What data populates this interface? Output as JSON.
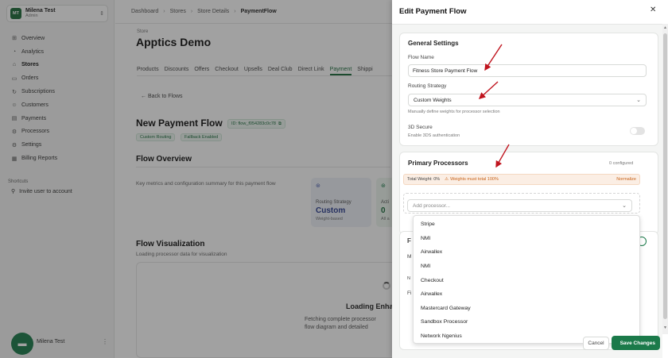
{
  "workspace": {
    "initials": "MT",
    "name": "Milena Test",
    "role": "Admin"
  },
  "sidebar": {
    "items": [
      {
        "label": "Overview",
        "icon": "grid-icon",
        "glyph": "⊞"
      },
      {
        "label": "Analytics",
        "icon": "analytics-icon",
        "glyph": "◔"
      },
      {
        "label": "Stores",
        "icon": "store-icon",
        "glyph": "⌂"
      },
      {
        "label": "Orders",
        "icon": "orders-icon",
        "glyph": "▭"
      },
      {
        "label": "Subscriptions",
        "icon": "subscriptions-icon",
        "glyph": "↻"
      },
      {
        "label": "Customers",
        "icon": "customers-icon",
        "glyph": "☺"
      },
      {
        "label": "Payments",
        "icon": "payments-icon",
        "glyph": "▤"
      },
      {
        "label": "Processors",
        "icon": "processors-icon",
        "glyph": "⚙"
      },
      {
        "label": "Settings",
        "icon": "settings-icon",
        "glyph": "⚙"
      },
      {
        "label": "Billing Reports",
        "icon": "billing-icon",
        "glyph": "▦"
      }
    ],
    "shortcuts_label": "Shortcuts",
    "shortcut_invite": "Invite user to account",
    "user_name": "Milena Test"
  },
  "breadcrumb": {
    "items": [
      "Dashboard",
      "Stores",
      "Store Details",
      "PaymentFlow"
    ]
  },
  "store": {
    "label": "Store",
    "title": "Apptics Demo"
  },
  "tabs": [
    "Products",
    "Discounts",
    "Offers",
    "Checkout",
    "Upsells",
    "Deal Club",
    "Direct Link",
    "Payment",
    "Shippi"
  ],
  "flow": {
    "back": "← Back to Flows",
    "title": "New Payment Flow",
    "id": "ID: flow_f054283c0c78",
    "badges": [
      "Custom Routing",
      "Fallback Enabled"
    ],
    "overview_title": "Flow Overview",
    "overview_text": "Key metrics and configuration summary for this payment flow",
    "card1_label": "Routing Strategy",
    "card1_value": "Custom",
    "card1_sub": "Weight-based",
    "card2_label": "Acti",
    "card2_value": "0",
    "card2_sub": "All a",
    "viz_title": "Flow Visualization",
    "viz_sub": "Loading processor data for visualization",
    "loading_title": "Loading Enha",
    "loading_line1": "Fetching complete processor",
    "loading_line2": "flow diagram and detailed"
  },
  "drawer": {
    "title": "Edit Payment Flow",
    "general_title": "General Settings",
    "flow_name_label": "Flow Name",
    "flow_name_value": "Fitness Store Payment Flow",
    "routing_label": "Routing Strategy",
    "routing_value": "Custom Weights",
    "routing_hint": "Manually define weights for processor selection",
    "secure_label": "3D Secure",
    "secure_hint": "Enable 3DS authentication",
    "primary_title": "Primary Processors",
    "configured": "0 configured",
    "total_weight": "Total Weight: 0%",
    "weight_warning": "Weights must total 100%",
    "normalize": "Normalize",
    "add_placeholder": "Add processor...",
    "peek_f": "F",
    "peek_m": "M",
    "peek_n": "N",
    "peek_fi": "Fi",
    "cancel": "Cancel",
    "save": "Save Changes"
  },
  "processor_options": [
    "Stripe",
    "NMI",
    "Airwallex",
    "NMI",
    "Checkout",
    "Airwallex",
    "Mastercard Gateway",
    "Sandbox Processor",
    "Network Ngenius"
  ],
  "colors": {
    "brand": "#1b7a4a",
    "warning": "#c8641b",
    "annotation_arrow": "#c0141e"
  }
}
